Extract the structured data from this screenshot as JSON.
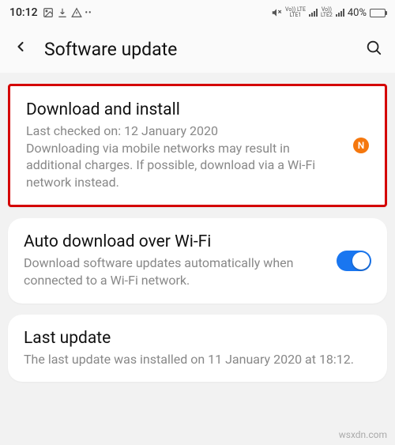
{
  "status_bar": {
    "time": "10:12",
    "battery_pct": "40%",
    "net_label_1a": "Vo)) LTE",
    "net_label_1b": "LTE1",
    "net_label_2a": "Vo))",
    "net_label_2b": "LTE2"
  },
  "header": {
    "title": "Software update"
  },
  "cards": {
    "download": {
      "title": "Download and install",
      "desc": "Last checked on: 12 January 2020\nDownloading via mobile networks may result in additional charges. If possible, download via a Wi-Fi network instead.",
      "badge": "N"
    },
    "auto": {
      "title": "Auto download over Wi-Fi",
      "desc": "Download software updates automatically when connected to a Wi-Fi network.",
      "toggle_on": true
    },
    "last": {
      "title": "Last update",
      "desc": "The last update was installed on 11 January 2020 at 18:12."
    }
  },
  "watermark": "wsxdn.com"
}
